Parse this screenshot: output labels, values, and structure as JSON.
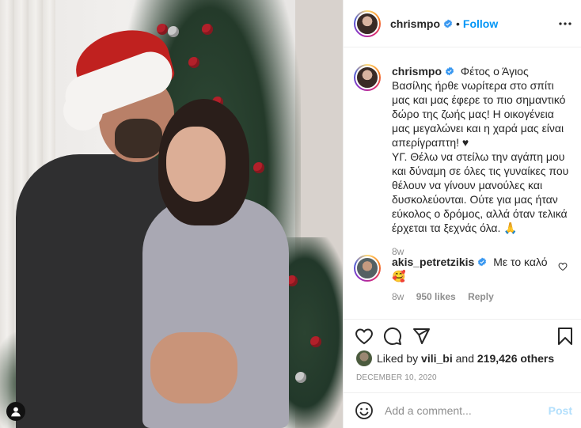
{
  "post": {
    "author": "chrismpo",
    "follow_label": "Follow",
    "separator": "•",
    "caption": "Φέτος ο Άγιος Βασίλης ήρθε νωρίτερα στο σπίτι μας και μας έφερε το πιο σημαντικό δώρο της ζωής μας! Η οικογένεια μας μεγαλώνει και η χαρά μας είναι απερίγραπτη! ♥",
    "caption_ps": "ΥΓ. Θέλω να στείλω την αγάπη μου και δύναμη σε όλες τις γυναίκες που θέλουν να γίνουν μανούλες και δυσκολεύονται. Ούτε για μας ήταν εύκολος ο δρόμος, αλλά όταν τελικά έρχεται τα ξεχνάς όλα. 🙏",
    "caption_age": "8w",
    "date": "DECEMBER 10, 2020"
  },
  "comments": [
    {
      "user": "akis_petretzikis",
      "text": "Με το καλό",
      "emoji": "🥰",
      "age": "8w",
      "likes": "950 likes",
      "reply_label": "Reply"
    }
  ],
  "likes": {
    "prefix": "Liked by",
    "user": "vili_bi",
    "conjunction": "and",
    "others": "219,426 others"
  },
  "add_comment": {
    "placeholder": "Add a comment...",
    "post_label": "Post"
  },
  "icons": {
    "more": "more-options-icon",
    "verified": "verified-badge-icon",
    "like": "heart-icon",
    "comment": "comment-icon",
    "share": "share-icon",
    "save": "bookmark-icon",
    "emoji": "emoji-icon",
    "tag": "user-tag-icon"
  },
  "colors": {
    "accent": "#0095f6",
    "post_disabled": "#b2dffc",
    "muted": "#8e8e8e",
    "text": "#262626"
  }
}
